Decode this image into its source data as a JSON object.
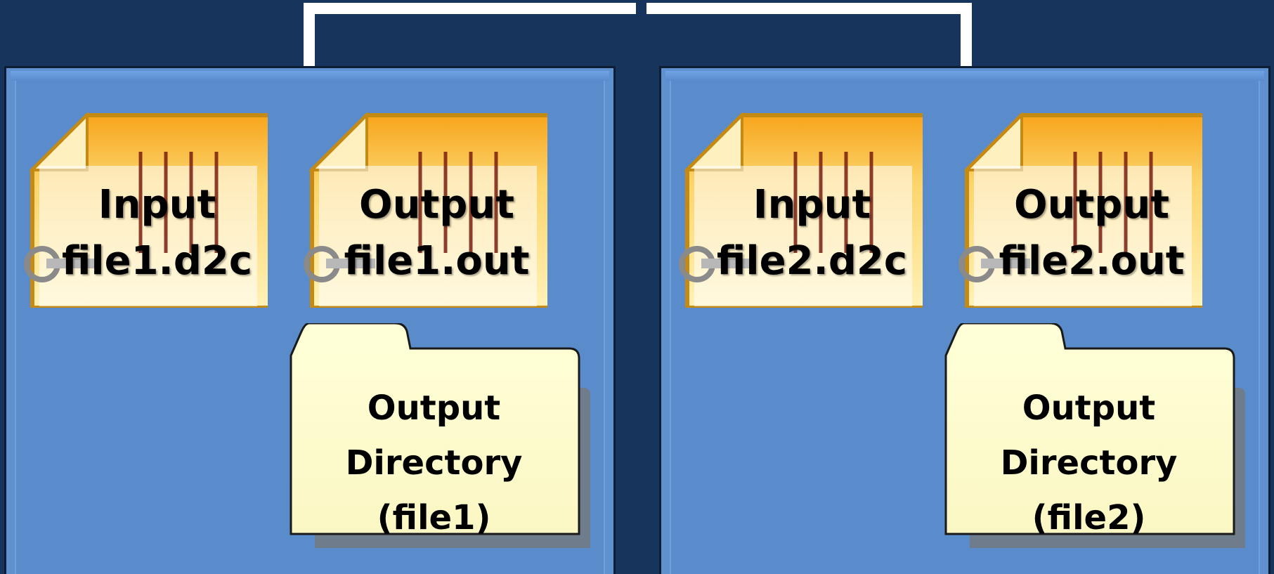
{
  "groups": [
    {
      "input_file": {
        "label": "Input",
        "name": "file1.d2c"
      },
      "output_file": {
        "label": "Output",
        "name": "file1.out"
      },
      "output_directory": {
        "line1": "Output",
        "line2": "Directory",
        "line3": "(file1)"
      }
    },
    {
      "input_file": {
        "label": "Input",
        "name": "file2.d2c"
      },
      "output_file": {
        "label": "Output",
        "name": "file2.out"
      },
      "output_directory": {
        "line1": "Output",
        "line2": "Directory",
        "line3": "(file2)"
      }
    }
  ],
  "colors": {
    "background": "#17355c",
    "panel": "#5a8ccc",
    "connector": "#ffffff",
    "file_border": "#c8900c",
    "file_fill": "#fff6c8",
    "folder_fill": "#ffffd0"
  },
  "icons": {
    "file": "document-icon",
    "folder": "folder-icon"
  }
}
